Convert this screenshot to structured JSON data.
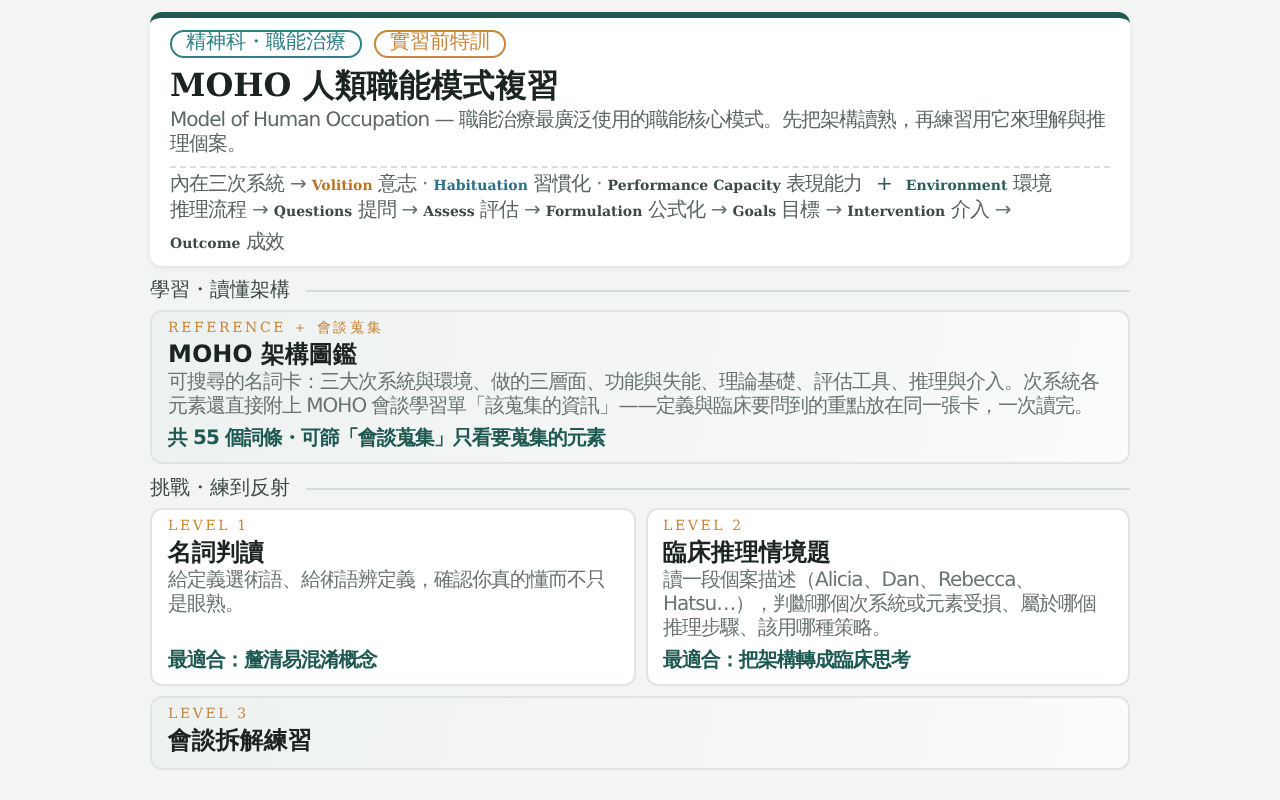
{
  "header": {
    "tags": [
      {
        "label": "精神科・職能治療",
        "color": "#2f7f86"
      },
      {
        "label": "實習前特訓",
        "color": "#c9853a"
      }
    ],
    "title": "MOHO 人類職能模式複習",
    "subtitle": "Model of Human Occupation — 職能治療最廣泛使用的職能核心模式。先把架構讀熟，再練習用它來理解與推理個案。",
    "flows": [
      {
        "label": "內在三次系統",
        "items": [
          {
            "sep": "→",
            "term": "Volition",
            "zh": "意志",
            "color": "#b8752b"
          },
          {
            "sep": "·",
            "term": "Habituation",
            "zh": "習慣化",
            "color": "#2f6f86"
          },
          {
            "sep": "·",
            "term": "Performance Capacity",
            "zh": "表現能力",
            "color": "#3c4a44"
          },
          {
            "sep": "+",
            "term": "Environment",
            "zh": "環境",
            "color": "#2c5d5a"
          }
        ]
      },
      {
        "label": "推理流程",
        "items": [
          {
            "sep": "→",
            "term": "Questions",
            "zh": "提問",
            "color": "#3c4a44"
          },
          {
            "sep": "→",
            "term": "Assess",
            "zh": "評估",
            "color": "#3c4a44"
          },
          {
            "sep": "→",
            "term": "Formulation",
            "zh": "公式化",
            "color": "#3c4a44"
          },
          {
            "sep": "→",
            "term": "Goals",
            "zh": "目標",
            "color": "#3c4a44"
          },
          {
            "sep": "→",
            "term": "Intervention",
            "zh": "介入",
            "color": "#3c4a44"
          },
          {
            "sep": "→",
            "term": "Outcome",
            "zh": "成效",
            "color": "#3c4a44"
          }
        ]
      }
    ]
  },
  "sections": [
    {
      "heading": "學習・讀懂架構",
      "cards": [
        {
          "kind": "wide",
          "eyebrow": "REFERENCE ＋ 會談蒐集",
          "title": "MOHO 架構圖鑑",
          "desc": "可搜尋的名詞卡：三大次系統與環境、做的三層面、功能與失能、理論基礎、評估工具、推理與介入。次系統各元素還直接附上 MOHO 會談學習單「該蒐集的資訊」——定義與臨床要問到的重點放在同一張卡，一次讀完。",
          "footer": "共 55 個詞條・可篩「會談蒐集」只看要蒐集的元素"
        }
      ]
    },
    {
      "heading": "挑戰・練到反射",
      "cards": [
        {
          "kind": "half",
          "eyebrow": "LEVEL 1",
          "title": "名詞判讀",
          "desc": "給定義選術語、給術語辨定義，確認你真的懂而不只是眼熟。",
          "footer": "最適合：釐清易混淆概念"
        },
        {
          "kind": "half",
          "eyebrow": "LEVEL 2",
          "title": "臨床推理情境題",
          "desc": "讀一段個案描述（Alicia、Dan、Rebecca、Hatsu…），判斷哪個次系統或元素受損、屬於哪個推理步驟、該用哪種策略。",
          "footer": "最適合：把架構轉成臨床思考"
        },
        {
          "kind": "wide",
          "eyebrow": "LEVEL 3",
          "title": "會談拆解練習"
        }
      ]
    }
  ]
}
